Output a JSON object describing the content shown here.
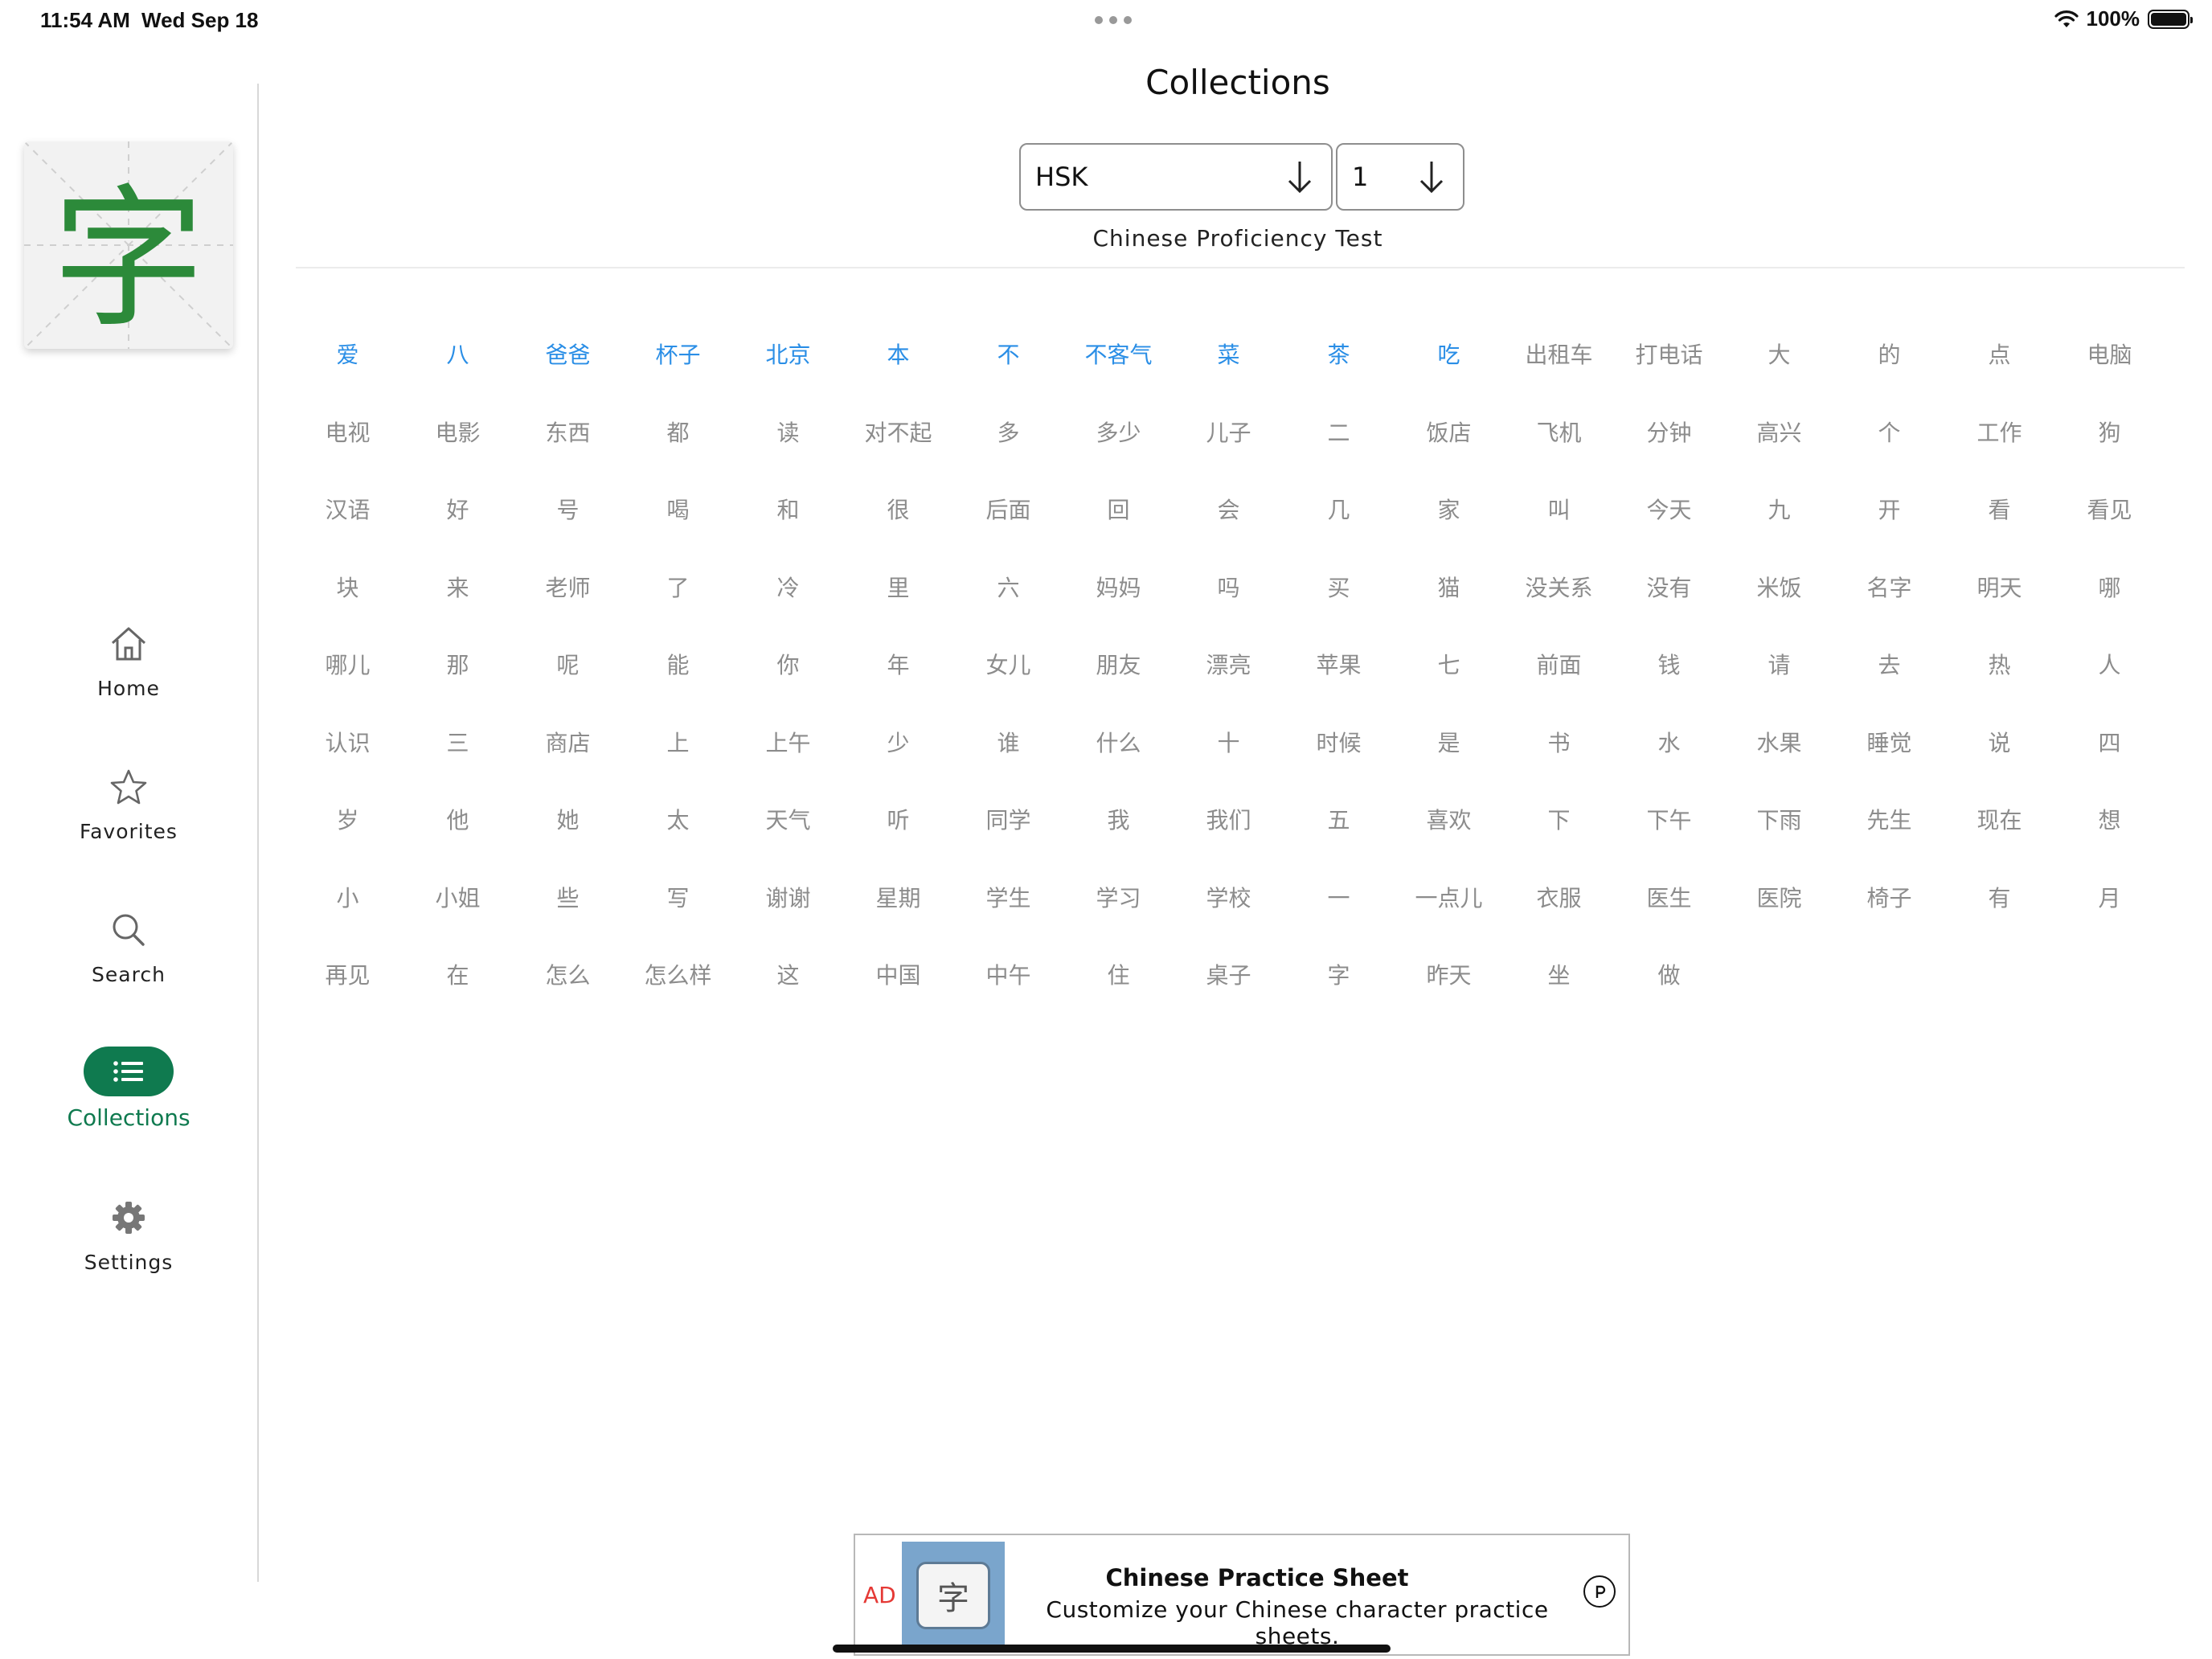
{
  "status_bar": {
    "time": "11:54 AM",
    "date": "Wed Sep 18",
    "battery": "100%"
  },
  "app_logo": {
    "character": "字",
    "accent_color": "#2c8a3a"
  },
  "nav": {
    "items": [
      {
        "label": "Home",
        "icon": "home-icon"
      },
      {
        "label": "Favorites",
        "icon": "star-icon"
      },
      {
        "label": "Search",
        "icon": "search-icon"
      },
      {
        "label": "Collections",
        "icon": "list-icon",
        "active": true
      },
      {
        "label": "Settings",
        "icon": "gear-icon"
      }
    ],
    "active_color": "#0f7a4f"
  },
  "header": {
    "title": "Collections",
    "collection_select": {
      "value": "HSK"
    },
    "level_select": {
      "value": "1"
    },
    "subtitle": "Chinese Proficiency Test"
  },
  "words": {
    "learned_color": "#2a8ee6",
    "default_color": "#8c8c8c",
    "learned": [
      "爱",
      "八",
      "爸爸",
      "杯子",
      "北京",
      "本",
      "不",
      "不客气",
      "菜",
      "茶",
      "吃"
    ],
    "others": [
      "出租车",
      "打电话",
      "大",
      "的",
      "点",
      "电脑",
      "电视",
      "电影",
      "东西",
      "都",
      "读",
      "对不起",
      "多",
      "多少",
      "儿子",
      "二",
      "饭店",
      "飞机",
      "分钟",
      "高兴",
      "个",
      "工作",
      "狗",
      "汉语",
      "好",
      "号",
      "喝",
      "和",
      "很",
      "后面",
      "回",
      "会",
      "几",
      "家",
      "叫",
      "今天",
      "九",
      "开",
      "看",
      "看见",
      "块",
      "来",
      "老师",
      "了",
      "冷",
      "里",
      "六",
      "妈妈",
      "吗",
      "买",
      "猫",
      "没关系",
      "没有",
      "米饭",
      "名字",
      "明天",
      "哪",
      "哪儿",
      "那",
      "呢",
      "能",
      "你",
      "年",
      "女儿",
      "朋友",
      "漂亮",
      "苹果",
      "七",
      "前面",
      "钱",
      "请",
      "去",
      "热",
      "人",
      "认识",
      "三",
      "商店",
      "上",
      "上午",
      "少",
      "谁",
      "什么",
      "十",
      "时候",
      "是",
      "书",
      "水",
      "水果",
      "睡觉",
      "说",
      "四",
      "岁",
      "他",
      "她",
      "太",
      "天气",
      "听",
      "同学",
      "我",
      "我们",
      "五",
      "喜欢",
      "下",
      "下午",
      "下雨",
      "先生",
      "现在",
      "想",
      "小",
      "小姐",
      "些",
      "写",
      "谢谢",
      "星期",
      "学生",
      "学习",
      "学校",
      "一",
      "一点儿",
      "衣服",
      "医生",
      "医院",
      "椅子",
      "有",
      "月",
      "再见",
      "在",
      "怎么",
      "怎么样",
      "这",
      "中国",
      "中午",
      "住",
      "桌子",
      "字",
      "昨天",
      "坐",
      "做"
    ]
  },
  "ad": {
    "tag": "AD",
    "title": "Chinese Practice Sheet",
    "description": "Customize your Chinese character practice sheets.",
    "image_character": "字"
  }
}
